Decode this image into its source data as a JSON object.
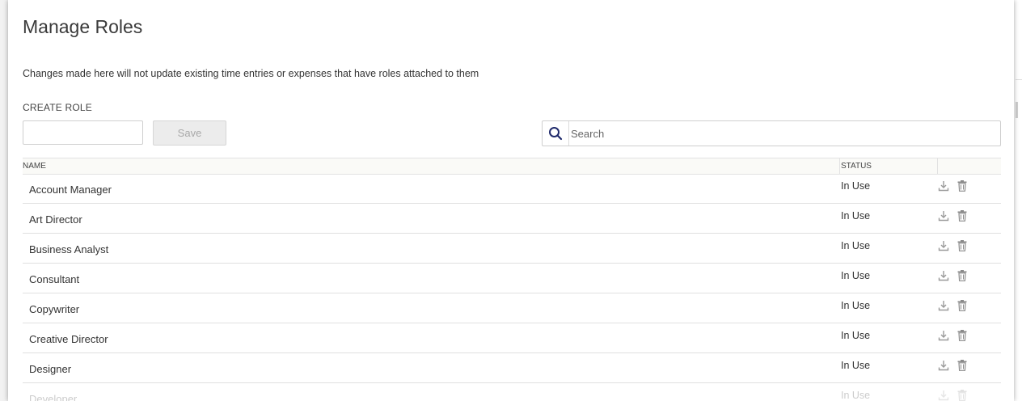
{
  "page": {
    "title": "Manage Roles",
    "description": "Changes made here will not update existing time entries or expenses that have roles attached to them"
  },
  "create": {
    "label": "CREATE ROLE",
    "input_value": "",
    "save_label": "Save"
  },
  "search": {
    "placeholder": "Search",
    "icon": "search-icon"
  },
  "table": {
    "columns": [
      "NAME",
      "STATUS",
      ""
    ],
    "rows": [
      {
        "name": "Account Manager",
        "status": "In Use"
      },
      {
        "name": "Art Director",
        "status": "In Use"
      },
      {
        "name": "Business Analyst",
        "status": "In Use"
      },
      {
        "name": "Consultant",
        "status": "In Use"
      },
      {
        "name": "Copywriter",
        "status": "In Use"
      },
      {
        "name": "Creative Director",
        "status": "In Use"
      },
      {
        "name": "Designer",
        "status": "In Use"
      },
      {
        "name": "Developer",
        "status": "In Use"
      }
    ],
    "row_icons": [
      "download-icon",
      "trash-icon"
    ]
  },
  "colors": {
    "accent": "#1f2a6b",
    "icon_gray": "#9a9a9a",
    "header_bg": "#fafaf7"
  }
}
